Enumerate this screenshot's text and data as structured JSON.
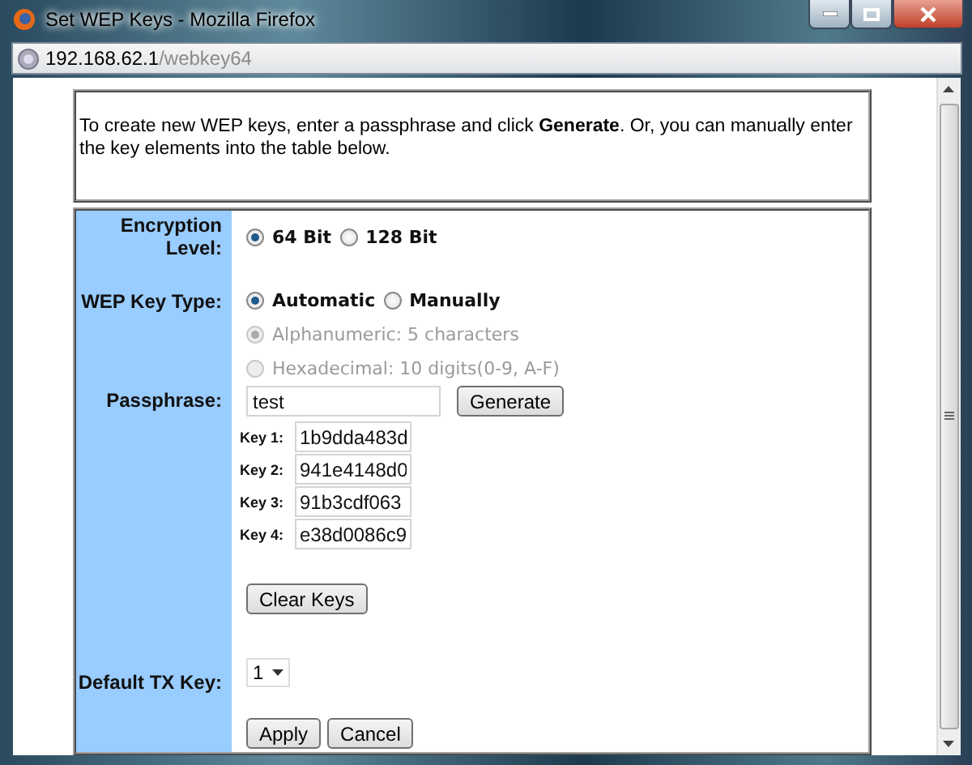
{
  "window": {
    "title": "Set WEP Keys - Mozilla Firefox"
  },
  "address": {
    "host": "192.168.62.1",
    "path": "/webkey64"
  },
  "intro": {
    "text": "To create new WEP keys, enter a passphrase and click **Generate**. Or, you can manually enter the key elements into the table below."
  },
  "encryption_level": {
    "label": "Encryption Level:",
    "options": [
      {
        "label": "64 Bit",
        "selected": true
      },
      {
        "label": "128 Bit",
        "selected": false
      }
    ]
  },
  "key_type": {
    "label": "WEP Key Type:",
    "options": [
      {
        "label": "Automatic",
        "selected": true
      },
      {
        "label": "Manually",
        "selected": false
      }
    ]
  },
  "key_format": [
    {
      "label": "Alphanumeric: 5 characters",
      "selected": true,
      "disabled": true
    },
    {
      "label": "Hexadecimal: 10 digits(0-9, A-F)",
      "selected": false,
      "disabled": true
    }
  ],
  "passphrase": {
    "label": "Passphrase:",
    "value": "test",
    "button": "Generate"
  },
  "keys": [
    {
      "label": "Key 1:",
      "value": "1b9dda483d"
    },
    {
      "label": "Key 2:",
      "value": "941e4148d0"
    },
    {
      "label": "Key 3:",
      "value": "91b3cdf063"
    },
    {
      "label": "Key 4:",
      "value": "e38d0086c9"
    }
  ],
  "clear_button": "Clear Keys",
  "default_tx_key": {
    "label": "Default TX Key:",
    "value": "1"
  },
  "buttons": [
    "Apply",
    "Cancel"
  ]
}
